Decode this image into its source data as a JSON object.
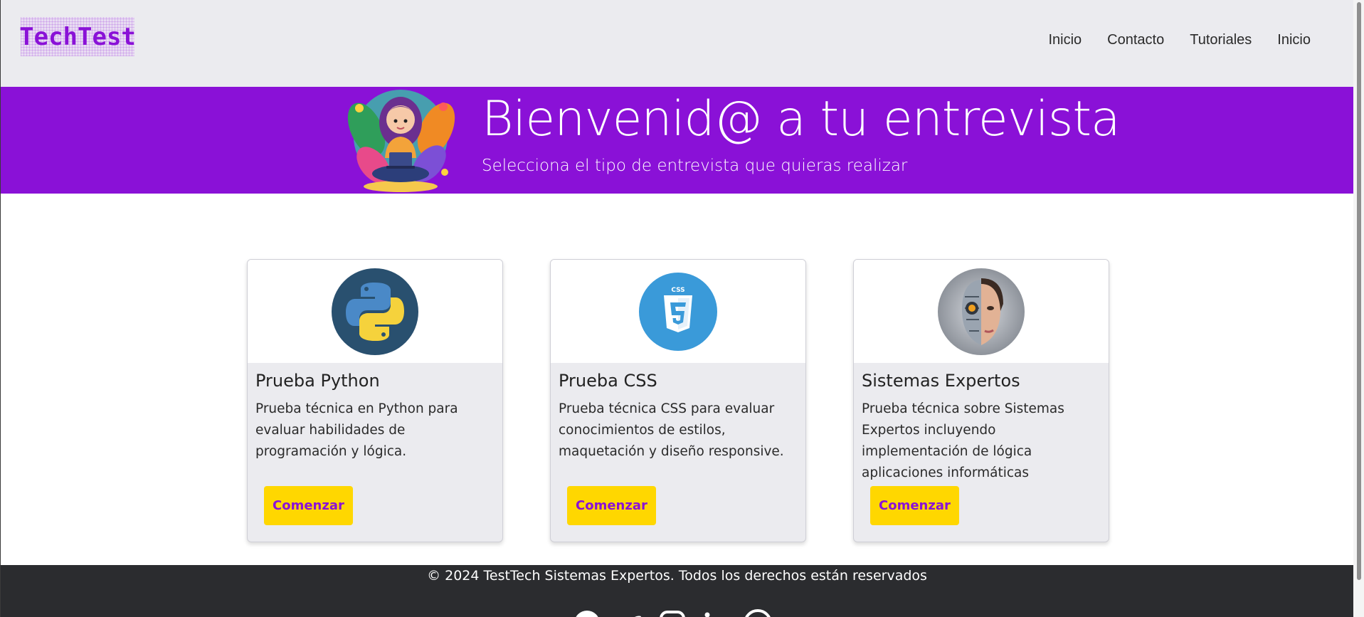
{
  "brand": {
    "logo_text": "TechTest",
    "accent": "#8a11d7",
    "button_color": "#ffd700"
  },
  "nav": {
    "items": [
      {
        "label": "Inicio"
      },
      {
        "label": "Contacto"
      },
      {
        "label": "Tutoriales"
      },
      {
        "label": "Inicio"
      }
    ]
  },
  "hero": {
    "title": "Bienvenid@ a tu entrevista",
    "subtitle": "Selecciona el tipo de entrevista que quieras realizar",
    "illustration": "girl-with-laptop-illustration"
  },
  "cards": [
    {
      "icon": "python-logo-icon",
      "title": "Prueba Python",
      "text": "Prueba técnica en Python para evaluar habilidades de programación y lógica.",
      "button": "Comenzar"
    },
    {
      "icon": "css3-logo-icon",
      "title": "Prueba CSS",
      "text": "Prueba técnica CSS para evaluar conocimientos de estilos, maquetación y diseño responsive.",
      "button": "Comenzar"
    },
    {
      "icon": "cyborg-face-icon",
      "title": "Sistemas Expertos",
      "text": "Prueba técnica sobre Sistemas Expertos incluyendo implementación de lógica aplicaciones informáticas",
      "button": "Comenzar"
    }
  ],
  "footer": {
    "copyright": "© 2024 TestTech Sistemas Expertos. Todos los derechos están reservados",
    "social_icons": [
      "github-icon",
      "twitter-icon",
      "instagram-icon",
      "linkedin-icon",
      "pinterest-icon"
    ]
  }
}
